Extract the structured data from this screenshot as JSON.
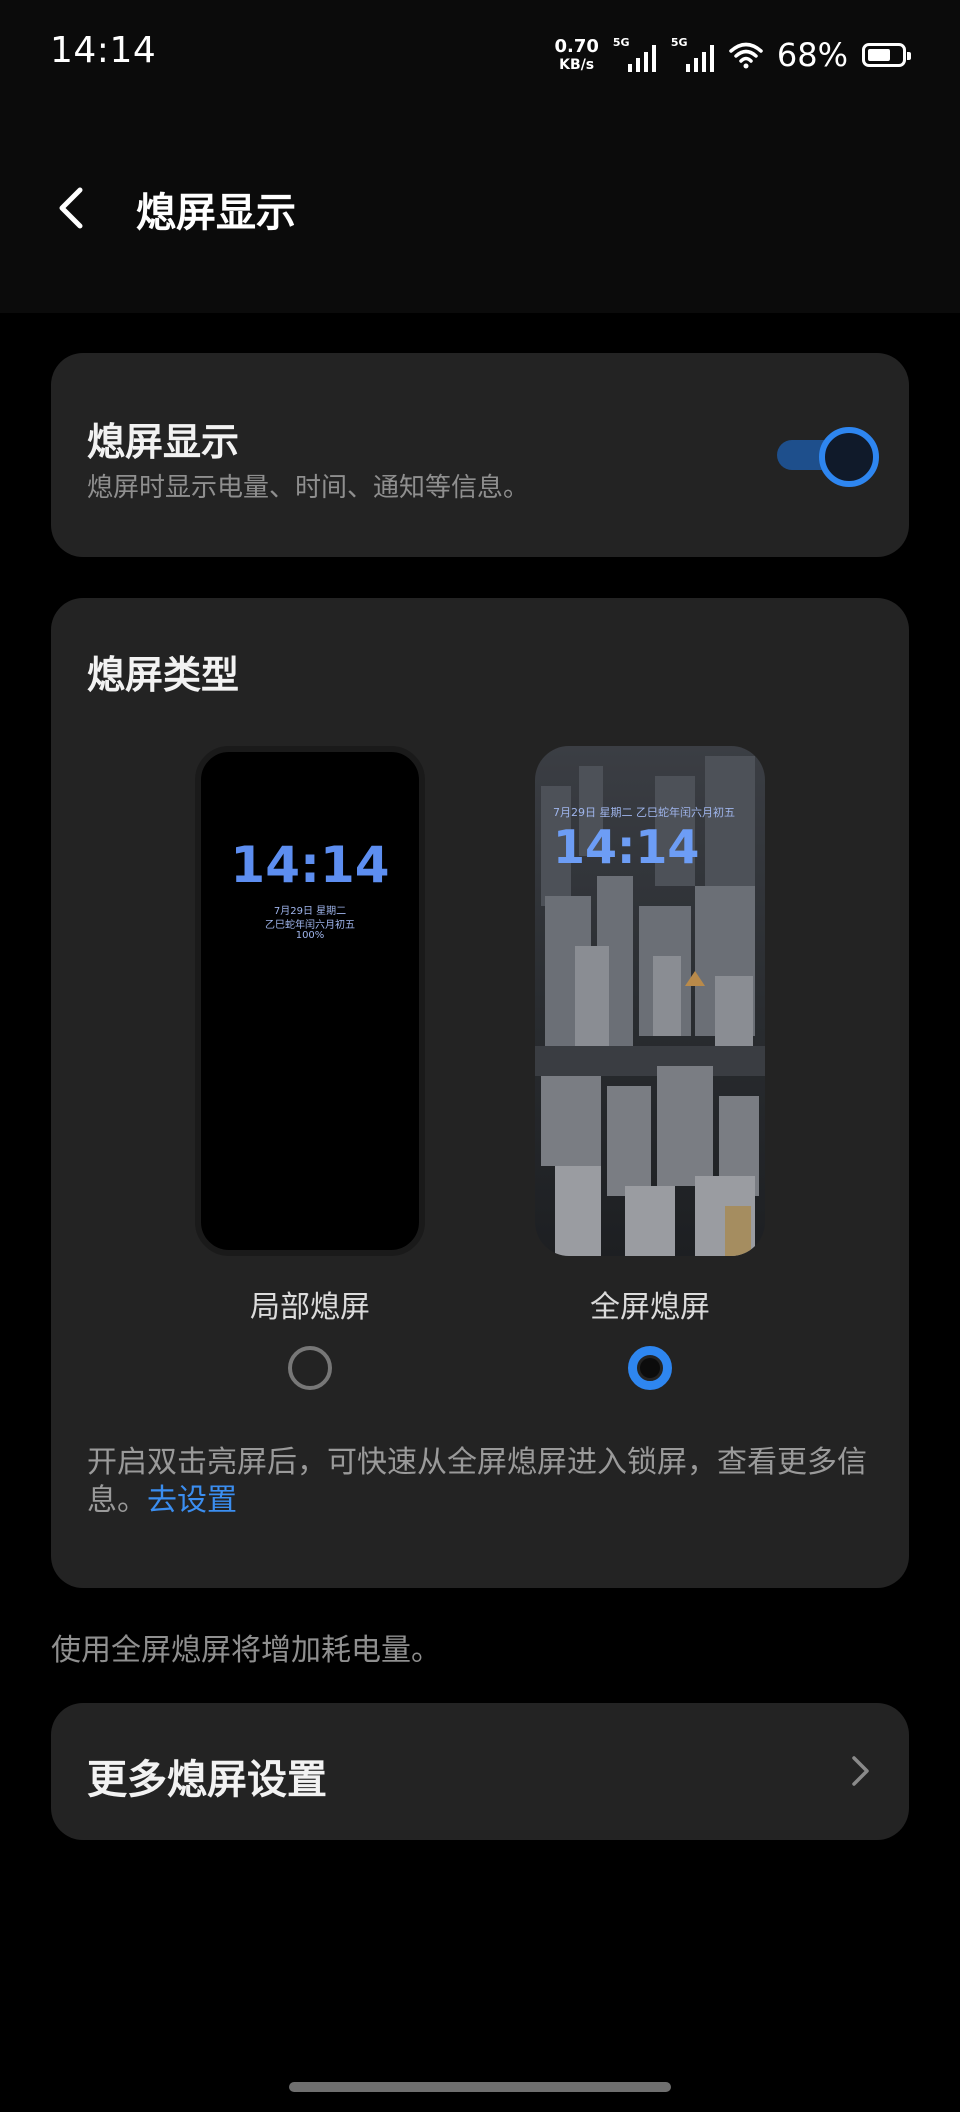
{
  "status_bar": {
    "time": "14:14",
    "net_speed_value": "0.70",
    "net_speed_unit": "KB/s",
    "sim1_label": "5G",
    "sim2_label": "5G",
    "battery_percent": "68%",
    "battery_level": 0.68
  },
  "header": {
    "title": "熄屏显示"
  },
  "aod_toggle": {
    "title": "熄屏显示",
    "subtitle": "熄屏时显示电量、时间、通知等信息。",
    "on": true
  },
  "aod_type": {
    "title": "熄屏类型",
    "options": [
      {
        "label": "局部熄屏",
        "selected": false,
        "preview": {
          "time": "14:14",
          "date": "7月29日 星期二",
          "lunar": "乙巳蛇年闰六月初五",
          "battery": "100%"
        }
      },
      {
        "label": "全屏熄屏",
        "selected": true,
        "preview": {
          "date": "7月29日 星期二 乙巳蛇年闰六月初五",
          "time": "14:14"
        }
      }
    ],
    "description": "开启双击亮屏后，可快速从全屏熄屏进入锁屏，查看更多信息。",
    "link": "去设置"
  },
  "footnote": "使用全屏熄屏将增加耗电量。",
  "more_settings": {
    "title": "更多熄屏设置"
  },
  "colors": {
    "accent": "#2e86f0",
    "card_bg": "#232323",
    "page_bg": "#000000"
  },
  "icons": {
    "back": "chevron-left-icon",
    "more": "chevron-right-icon",
    "wifi": "wifi-icon",
    "signal": "signal-icon",
    "battery": "battery-icon"
  }
}
